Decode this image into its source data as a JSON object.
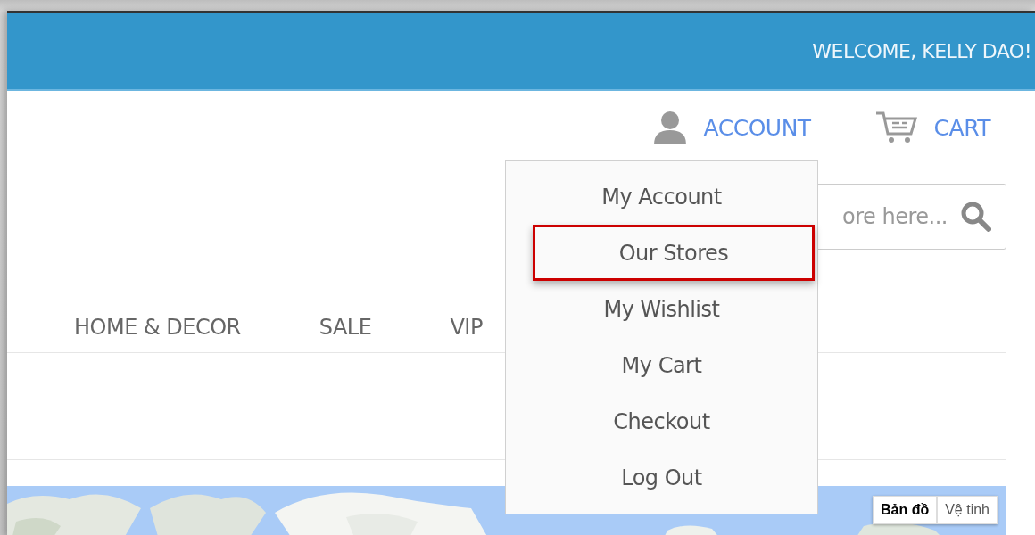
{
  "top_bar": {
    "welcome": "WELCOME, KELLY DAO!"
  },
  "header_links": [
    {
      "kind": "account",
      "label": "ACCOUNT"
    },
    {
      "kind": "cart",
      "label": "CART"
    }
  ],
  "search": {
    "placeholder": "ore here..."
  },
  "nav": [
    "HOME & DECOR",
    "SALE",
    "VIP"
  ],
  "account_menu": [
    {
      "label": "My Account",
      "selected": false
    },
    {
      "label": "Our Stores",
      "selected": true
    },
    {
      "label": "My Wishlist",
      "selected": false
    },
    {
      "label": "My Cart",
      "selected": false
    },
    {
      "label": "Checkout",
      "selected": false
    },
    {
      "label": "Log Out",
      "selected": false
    }
  ],
  "map": {
    "types": [
      {
        "label": "Bản đồ",
        "selected": true
      },
      {
        "label": "Vệ tinh",
        "selected": false
      }
    ]
  }
}
